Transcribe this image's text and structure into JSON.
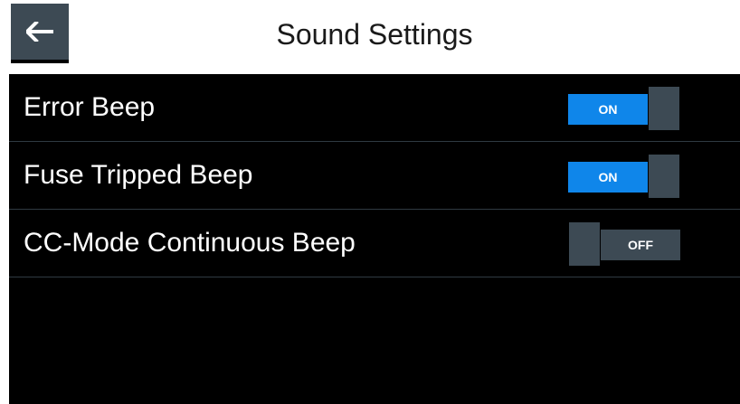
{
  "header": {
    "title": "Sound Settings",
    "back_icon": "arrow-left-icon"
  },
  "colors": {
    "background": "#000000",
    "header_background": "#ffffff",
    "toggle_on": "#0f86ea",
    "toggle_knob": "#3d4a54",
    "divider": "#2f3a42"
  },
  "settings": [
    {
      "label": "Error Beep",
      "state": "ON",
      "enabled": true
    },
    {
      "label": "Fuse Tripped Beep",
      "state": "ON",
      "enabled": true
    },
    {
      "label": "CC-Mode Continuous Beep",
      "state": "OFF",
      "enabled": false
    }
  ]
}
